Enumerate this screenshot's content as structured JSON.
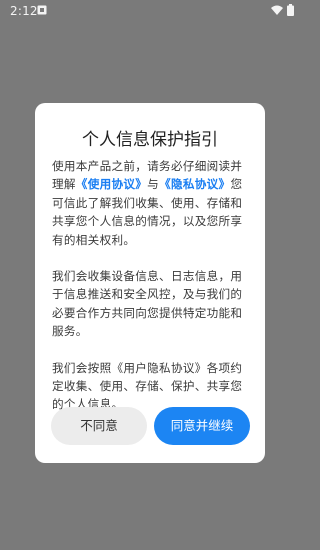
{
  "status_bar": {
    "time": "2:12",
    "notification_icon": "notification-icon",
    "wifi_icon": "wifi-icon",
    "battery_icon": "battery-icon"
  },
  "dialog": {
    "title": "个人信息保护指引",
    "paragraph1": {
      "prefix": "使用本产品之前，请务必仔细阅读并理解",
      "link_terms": "《使用协议》",
      "conjunction": "与",
      "link_privacy": "《隐私协议》",
      "suffix": "您可信此了解我们收集、使用、存储和共享您个人信息的情况，以及您所享有的相关权利。"
    },
    "paragraph2": "我们会收集设备信息、日志信息，用于信息推送和安全风控，及与我们的必要合作方共同向您提供特定功能和服务。",
    "paragraph3": "我们会按照《用户隐私协议》各项约定收集、使用、存储、保护、共享您的个人信息。",
    "decline_label": "不同意",
    "accept_label": "同意并继续"
  },
  "colors": {
    "overlay": "#7a7a7a",
    "accent": "#1c85f3",
    "link": "#1a7ef2"
  }
}
